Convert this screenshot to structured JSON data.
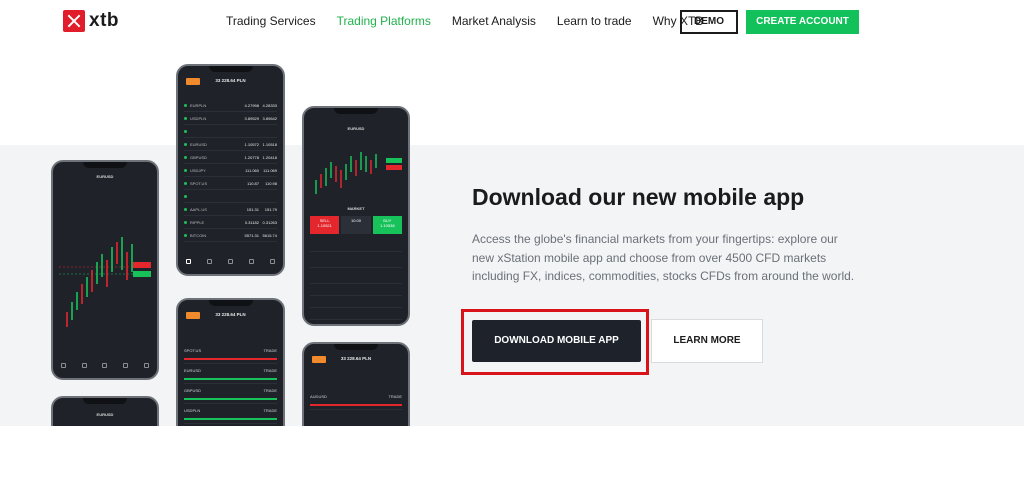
{
  "brand": {
    "name": "xtb",
    "logo_icon": "xtb-x-logo-icon",
    "accent": "#e11c2b"
  },
  "nav": {
    "items": [
      {
        "label": "Trading Services",
        "active": false
      },
      {
        "label": "Trading Platforms",
        "active": true
      },
      {
        "label": "Market Analysis",
        "active": false
      },
      {
        "label": "Learn to trade",
        "active": false
      },
      {
        "label": "Why XTB",
        "active": false
      }
    ],
    "demo_label": "DEMO",
    "create_label": "CREATE ACCOUNT",
    "active_color": "#21b14c",
    "create_color": "#12c15a"
  },
  "hero": {
    "headline": "Download our new mobile app",
    "description": "Access the globe's financial markets from your fingertips: explore our new xStation mobile app and choose from over 4500 CFD markets including FX, indices, commodities, stocks CFDs from around the world.",
    "download_label": "DOWNLOAD MOBILE APP",
    "learn_label": "LEARN MORE",
    "highlight_color": "#d8131a"
  },
  "phones": {
    "balance": "33 228.64 PLN",
    "market_list": [
      {
        "name": "EURPLN",
        "v1": "4.27998",
        "v2": "4.28333"
      },
      {
        "name": "USDPLN",
        "v1": "3.89529",
        "v2": "3.89642"
      },
      {
        "name": "",
        "v1": "",
        "v2": ""
      },
      {
        "name": "EURUSD",
        "v1": "1.10572",
        "v2": "1.10518"
      },
      {
        "name": "GBPUSD",
        "v1": "1.20778",
        "v2": "1.20418"
      },
      {
        "name": "USDJPY",
        "v1": "111.060",
        "v2": "111.069"
      },
      {
        "name": "SPOT.US",
        "v1": "110.87",
        "v2": "110.98"
      },
      {
        "name": "",
        "v1": "",
        "v2": ""
      },
      {
        "name": "AAPL.US",
        "v1": "151.31",
        "v2": "151.79"
      },
      {
        "name": "RIPPLE",
        "v1": "0.31182",
        "v2": "0.31263"
      },
      {
        "name": "BITCOIN",
        "v1": "5571.31",
        "v2": "5615.74"
      }
    ],
    "chart_phone_title": "EURUSD",
    "trade_phone_title": "EURUSD",
    "sell_label": "SELL",
    "sell_price": "1.10521",
    "qty": "10.00",
    "buy_label": "BUY",
    "buy_price": "1.10538",
    "market_label": "MARKET",
    "positions": [
      {
        "name": "SPOT.US",
        "action": "TRADE",
        "color": "#e4262d"
      },
      {
        "name": "EURUSD",
        "action": "TRADE",
        "color": "#18c25a"
      },
      {
        "name": "GBPUSD",
        "action": "TRADE",
        "color": "#18c25a"
      },
      {
        "name": "USDPLN",
        "action": "TRADE",
        "color": "#18c25a"
      }
    ],
    "bottom_right_row": {
      "name": "AUDUSD",
      "action": "TRADE"
    }
  }
}
